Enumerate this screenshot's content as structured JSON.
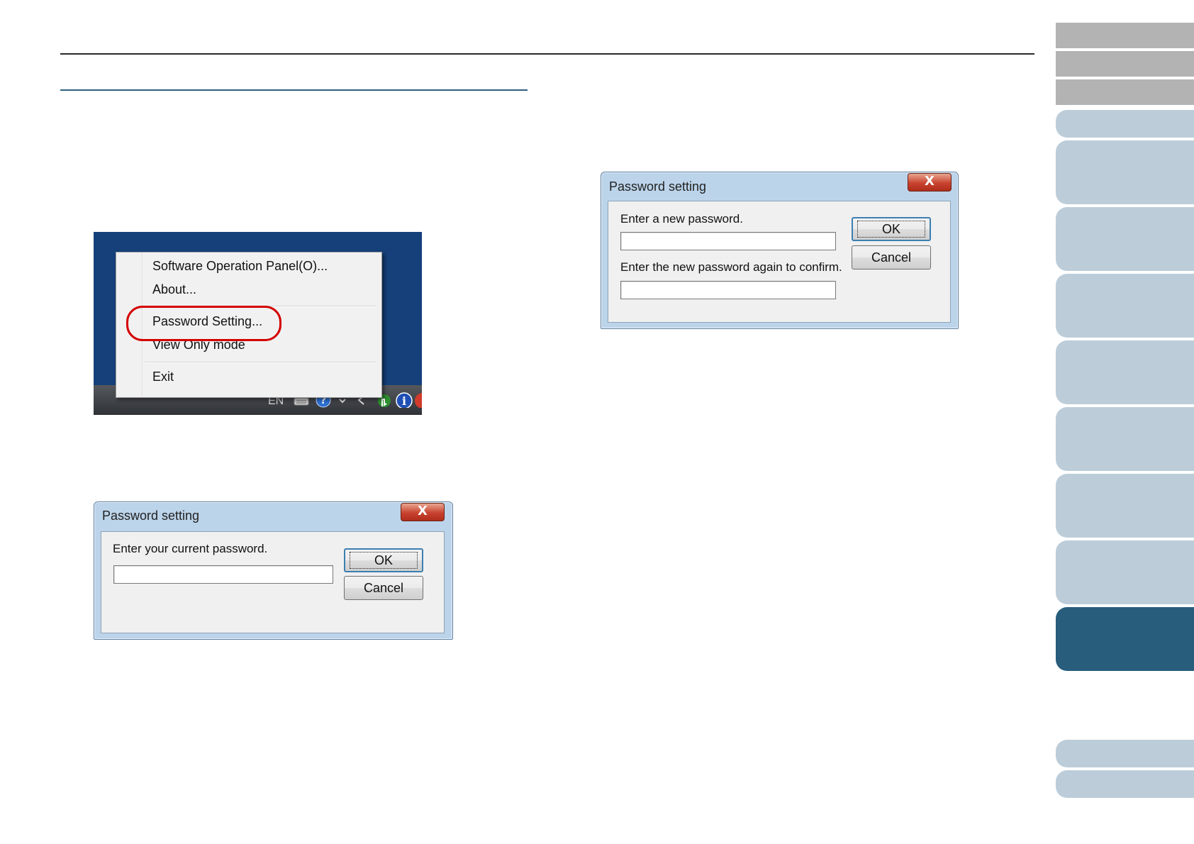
{
  "tray_menu": {
    "items": [
      "Software Operation Panel(O)...",
      "About...",
      "Password Setting...",
      "View Only mode",
      "Exit"
    ],
    "taskbar_lang": "EN",
    "highlighted_item": "Password Setting..."
  },
  "dialog_current": {
    "title": "Password setting",
    "close_glyph": "X",
    "prompt": "Enter your current password.",
    "ok_label": "OK",
    "cancel_label": "Cancel"
  },
  "dialog_new": {
    "title": "Password setting",
    "close_glyph": "X",
    "prompt_new": "Enter a new password.",
    "prompt_confirm": "Enter the new password again to confirm.",
    "ok_label": "OK",
    "cancel_label": "Cancel"
  },
  "side_nav": {
    "tabs": [
      "gray",
      "gray",
      "gray",
      "light",
      "light",
      "light",
      "light",
      "light",
      "light",
      "light",
      "light",
      "dark",
      "light",
      "light"
    ],
    "active_index": 11
  },
  "colors": {
    "accent_dark": "#285d7c",
    "accent_light": "#bccdd9",
    "highlight_ring": "#d40000",
    "desktop_bg": "#15407a"
  }
}
